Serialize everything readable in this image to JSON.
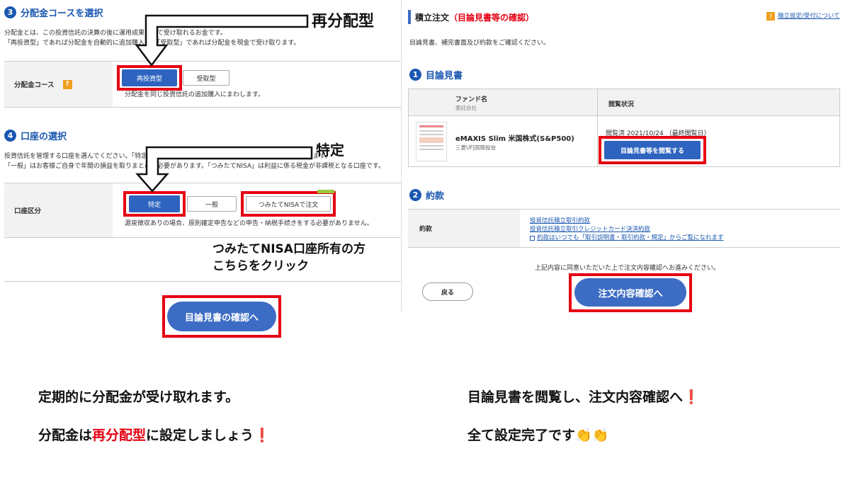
{
  "left": {
    "sec3": {
      "num": "3",
      "title": "分配金コースを選択"
    },
    "sec3_desc1": "分配金とは、この投資信託の決算の後に運用成果として受け取れるお金です。",
    "sec3_desc2": "「再投資型」であれば分配金を自動的に追加購入し、「受取型」であれば分配金を現金で受け取ります。",
    "course_label": "分配金コース",
    "help_icon": "?",
    "reinvest_btn": "再投資型",
    "receive_btn": "受取型",
    "course_note": "分配金を同じ投資信託の追加購入にまわします。",
    "sec4": {
      "num": "4",
      "title": "口座の選択"
    },
    "sec4_desc1": "投資信託を管理する口座を選んでください。「特定」は楽天証券がお客様に代わって年間の損益を取りまとめます。",
    "sec4_desc2": "「一般」はお客様ご自身で年間の損益を取りまとめる必要があります。「つみたてNISA」は利益に係る税金が非課税となる口座です。",
    "account_label": "口座区分",
    "tokutei_btn": "特定",
    "ippan_btn": "一般",
    "nisa_btn": "つみたてNISAで注文",
    "account_note": "源泉徴収ありの場合、原則確定申告などの申告・納税手続きをする必要がありません。",
    "confirm_btn": "目論見書の確認へ"
  },
  "right": {
    "header_title": "積立注文",
    "header_sub": "（目論見書等の確認）",
    "help_link": "積立設定/受付について",
    "intro": "目論見書、補完書面及び約款をご確認ください。",
    "sec1": {
      "num": "1",
      "title": "目論見書"
    },
    "col_fund": "ファンド名",
    "col_company": "委託会社",
    "col_status": "閲覧状況",
    "fund_name": "eMAXIS Slim 米国株式(S&P500)",
    "fund_company": "三菱UFJ国際投信",
    "status_text": "閲覧済 2021/10/24 （最終閲覧日）",
    "view_btn": "目論見書等を閲覧する",
    "sec2": {
      "num": "2",
      "title": "約款"
    },
    "terms_label": "約款",
    "link1": "投資信託積立取引約款",
    "link2": "投資信託積立取引クレジットカード決済約款",
    "link3": "約款はいつでも「取引説明書・取引約款・規定」からご覧になれます",
    "agree_text": "上記内容に同意いただいた上で注文内容確認へお進みください。",
    "back_btn": "戻る",
    "order_btn": "注文内容確認へ"
  },
  "annotations": {
    "saibunpai": "再分配型",
    "tokutei": "特定",
    "nisa_line1": "つみたてNISA口座所有の方",
    "nisa_line2": "こちらをクリック"
  },
  "captions": {
    "left1": "定期的に分配金が受け取れます。",
    "left2_a": "分配金は",
    "left2_red": "再分配型",
    "left2_b": "に設定しましょう",
    "left2_mark": "❗",
    "right1": "目論見書を閲覧し、注文内容確認へ",
    "right1_mark": "❗",
    "right2": "全て設定完了です",
    "right2_emoji": "👏👏"
  }
}
